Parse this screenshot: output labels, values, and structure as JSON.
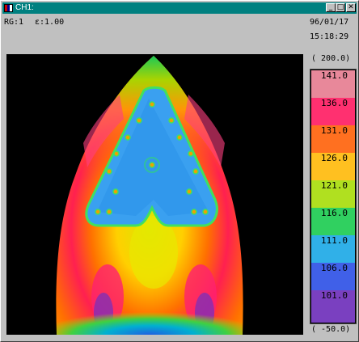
{
  "window": {
    "title": "CH1:",
    "buttons": {
      "minimize": "_",
      "maximize": "□",
      "close": "✕"
    }
  },
  "info": {
    "range": "RG:1",
    "emissivity": "ε:1.00",
    "date": "96/01/17",
    "time": "15:18:29"
  },
  "scale": {
    "max_label": "( 200.0)",
    "min_label": "( -50.0)",
    "ticks": [
      "141.0",
      "136.0",
      "131.0",
      "126.0",
      "121.0",
      "116.0",
      "111.0",
      "106.0",
      "101.0"
    ],
    "colors": [
      "#e07a8f",
      "#ff2060",
      "#ff6a00",
      "#ffc000",
      "#a0e000",
      "#00c040",
      "#20a0e0",
      "#3030e0",
      "#5a1aa0"
    ]
  },
  "image": {
    "icon": "thermal-image"
  }
}
